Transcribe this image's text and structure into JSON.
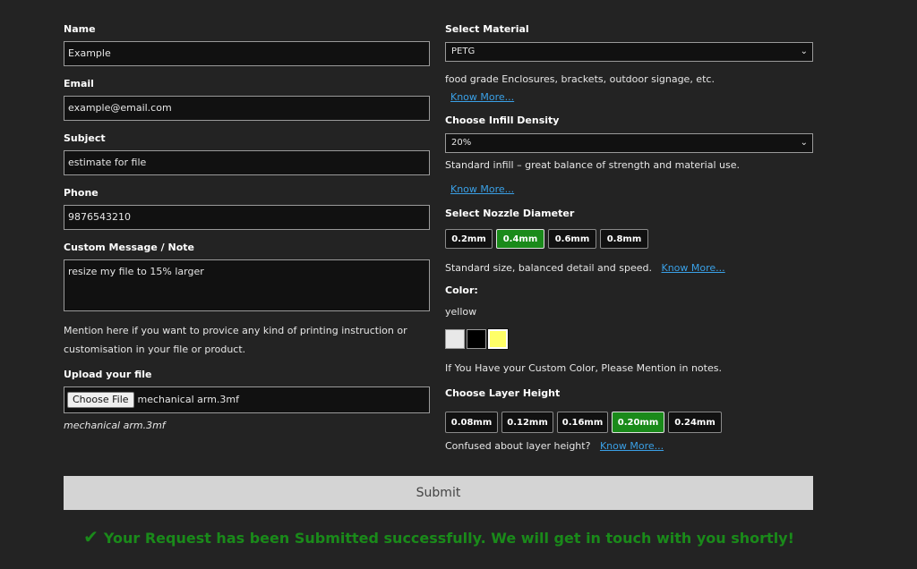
{
  "form": {
    "name": {
      "label": "Name",
      "value": "Example"
    },
    "email": {
      "label": "Email",
      "value": "example@email.com"
    },
    "subject": {
      "label": "Subject",
      "value": "estimate for file"
    },
    "phone": {
      "label": "Phone",
      "value": "9876543210"
    },
    "message": {
      "label": "Custom Message / Note",
      "value": "resize my file to 15% larger"
    },
    "message_help": "Mention here if you want to provice any kind of printing instruction or customisation in your file or product.",
    "upload": {
      "label": "Upload your file",
      "button": "Choose File",
      "file_name": "mechanical arm.3mf",
      "file_name_display": "mechanical arm.3mf"
    }
  },
  "material": {
    "label": "Select Material",
    "selected": "PETG",
    "description": "food grade Enclosures, brackets, outdoor signage, etc.",
    "know_more": "Know More..."
  },
  "infill": {
    "label": "Choose Infill Density",
    "selected": "20%",
    "description": "Standard infill – great balance of strength and material use.",
    "know_more": "Know More..."
  },
  "nozzle": {
    "label": "Select Nozzle Diameter",
    "options": [
      "0.2mm",
      "0.4mm",
      "0.6mm",
      "0.8mm"
    ],
    "active_index": 1,
    "description": "Standard size, balanced detail and speed.",
    "know_more": "Know More..."
  },
  "color": {
    "label": "Color:",
    "selected_name": "yellow",
    "swatches": [
      "#e8e8e8",
      "#000000",
      "#ffff66"
    ],
    "selected_index": 2,
    "note": "If You Have your Custom Color, Please Mention in notes."
  },
  "layer": {
    "label": "Choose Layer Height",
    "options": [
      "0.08mm",
      "0.12mm",
      "0.16mm",
      "0.20mm",
      "0.24mm"
    ],
    "active_index": 3,
    "question": "Confused about layer height?",
    "know_more": "Know More..."
  },
  "submit": {
    "label": "Submit"
  },
  "success": {
    "message": "Your Request has been Submitted successfully. We will get in touch with you shortly!"
  },
  "colors": {
    "accent_green": "#1a8a1a",
    "link_blue": "#3aa0e6"
  }
}
